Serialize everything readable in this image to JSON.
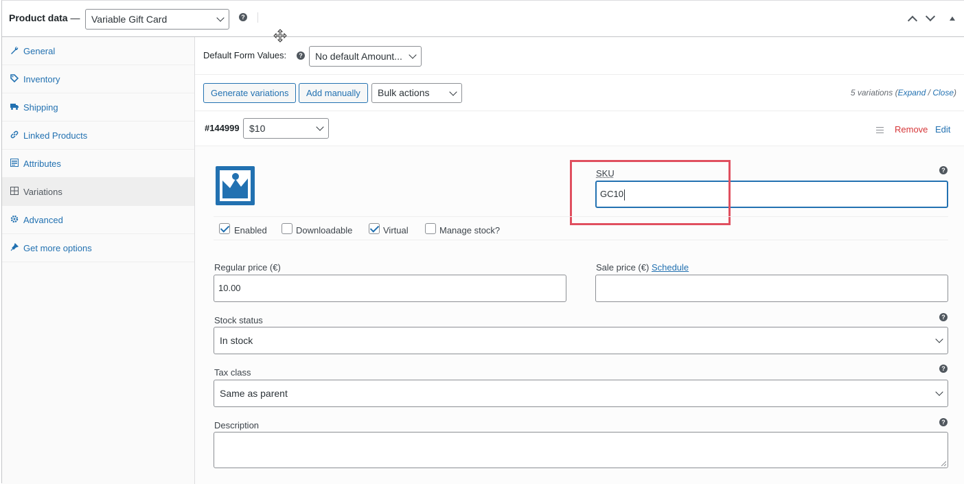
{
  "header": {
    "title": "Product data",
    "separator": "—",
    "product_type": "Variable Gift Card"
  },
  "sidebar": {
    "items": [
      {
        "label": "General",
        "icon": "wrench-icon"
      },
      {
        "label": "Inventory",
        "icon": "tag-icon"
      },
      {
        "label": "Shipping",
        "icon": "truck-icon"
      },
      {
        "label": "Linked Products",
        "icon": "link-icon"
      },
      {
        "label": "Attributes",
        "icon": "list-icon"
      },
      {
        "label": "Variations",
        "icon": "grid-icon",
        "active": true
      },
      {
        "label": "Advanced",
        "icon": "gear-icon"
      },
      {
        "label": "Get more options",
        "icon": "plugin-icon"
      }
    ]
  },
  "defaults": {
    "label": "Default Form Values:",
    "value": "No default Amount..."
  },
  "toolbar": {
    "generate_label": "Generate variations",
    "add_label": "Add manually",
    "bulk_label": "Bulk actions",
    "count_text": "5 variations",
    "expand_label": "Expand",
    "slash": "/",
    "close_label": "Close"
  },
  "variation": {
    "id": "#144999",
    "amount": "$10",
    "remove_label": "Remove",
    "edit_label": "Edit",
    "sku_label": "SKU",
    "sku_value": "GC10",
    "checkboxes": [
      {
        "label": "Enabled",
        "checked": true
      },
      {
        "label": "Downloadable",
        "checked": false
      },
      {
        "label": "Virtual",
        "checked": true
      },
      {
        "label": "Manage stock?",
        "checked": false
      }
    ],
    "regular_price_label": "Regular price (€)",
    "regular_price_value": "10.00",
    "sale_price_label": "Sale price (€)",
    "schedule_label": "Schedule",
    "sale_price_value": "",
    "stock_status_label": "Stock status",
    "stock_status_value": "In stock",
    "tax_class_label": "Tax class",
    "tax_class_value": "Same as parent",
    "description_label": "Description",
    "description_value": ""
  },
  "colors": {
    "accent": "#2271b1",
    "remove": "#d63638",
    "highlight": "#e04f5f"
  }
}
